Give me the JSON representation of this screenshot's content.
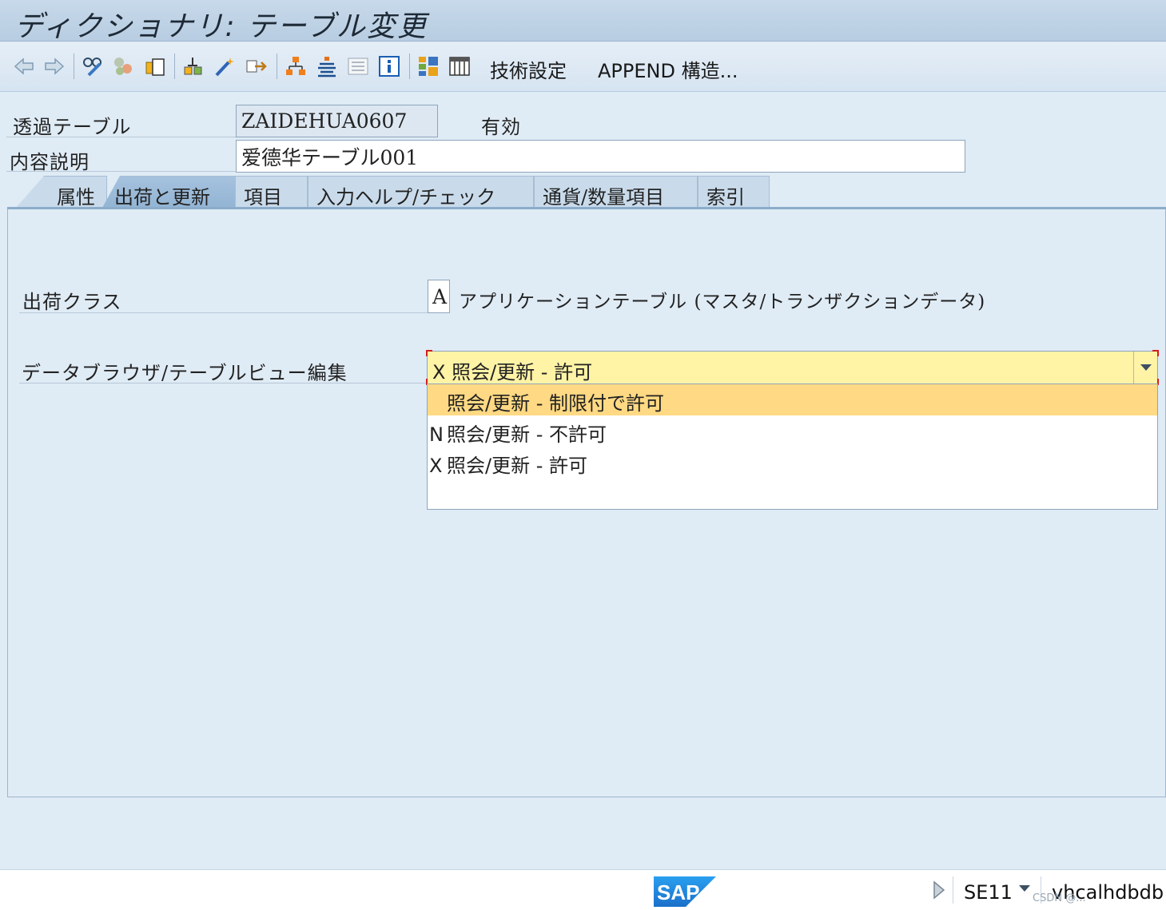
{
  "window": {
    "title": "ディクショナリ: テーブル変更"
  },
  "toolbar": {
    "tech_settings": "技術設定",
    "append_structure": "APPEND 構造..."
  },
  "header": {
    "transparent_table_label": "透過テーブル",
    "table_name": "ZAIDEHUA0607",
    "status": "有効",
    "description_label": "内容説明",
    "description_value": "爱德华テーブル001"
  },
  "tabs": [
    {
      "label": "属性"
    },
    {
      "label": "出荷と更新"
    },
    {
      "label": "項目"
    },
    {
      "label": "入力ヘルプ/チェック"
    },
    {
      "label": "通貨/数量項目"
    },
    {
      "label": "索引"
    }
  ],
  "form": {
    "delivery_class_label": "出荷クラス",
    "delivery_class_value": "A",
    "delivery_class_text": "アプリケーションテーブル (マスタ/トランザクションデータ)",
    "data_browser_label": "データブラウザ/テーブルビュー編集",
    "data_browser_value": "X 照会/更新 - 許可",
    "options": [
      {
        "key": "",
        "text": "照会/更新 - 制限付で許可",
        "selected": true
      },
      {
        "key": "N",
        "text": "照会/更新 - 不許可",
        "selected": false
      },
      {
        "key": "X",
        "text": "照会/更新 - 許可",
        "selected": false
      }
    ]
  },
  "statusbar": {
    "logo": "SAP",
    "transaction": "SE11",
    "server": "vhcalhdbdb",
    "watermark": "CSDN @..."
  },
  "colors": {
    "accent": "#93b4d4",
    "dropdown_bg": "#fff3a6",
    "selection": "#ffd983",
    "sap_blue": "#1f7ad6"
  }
}
